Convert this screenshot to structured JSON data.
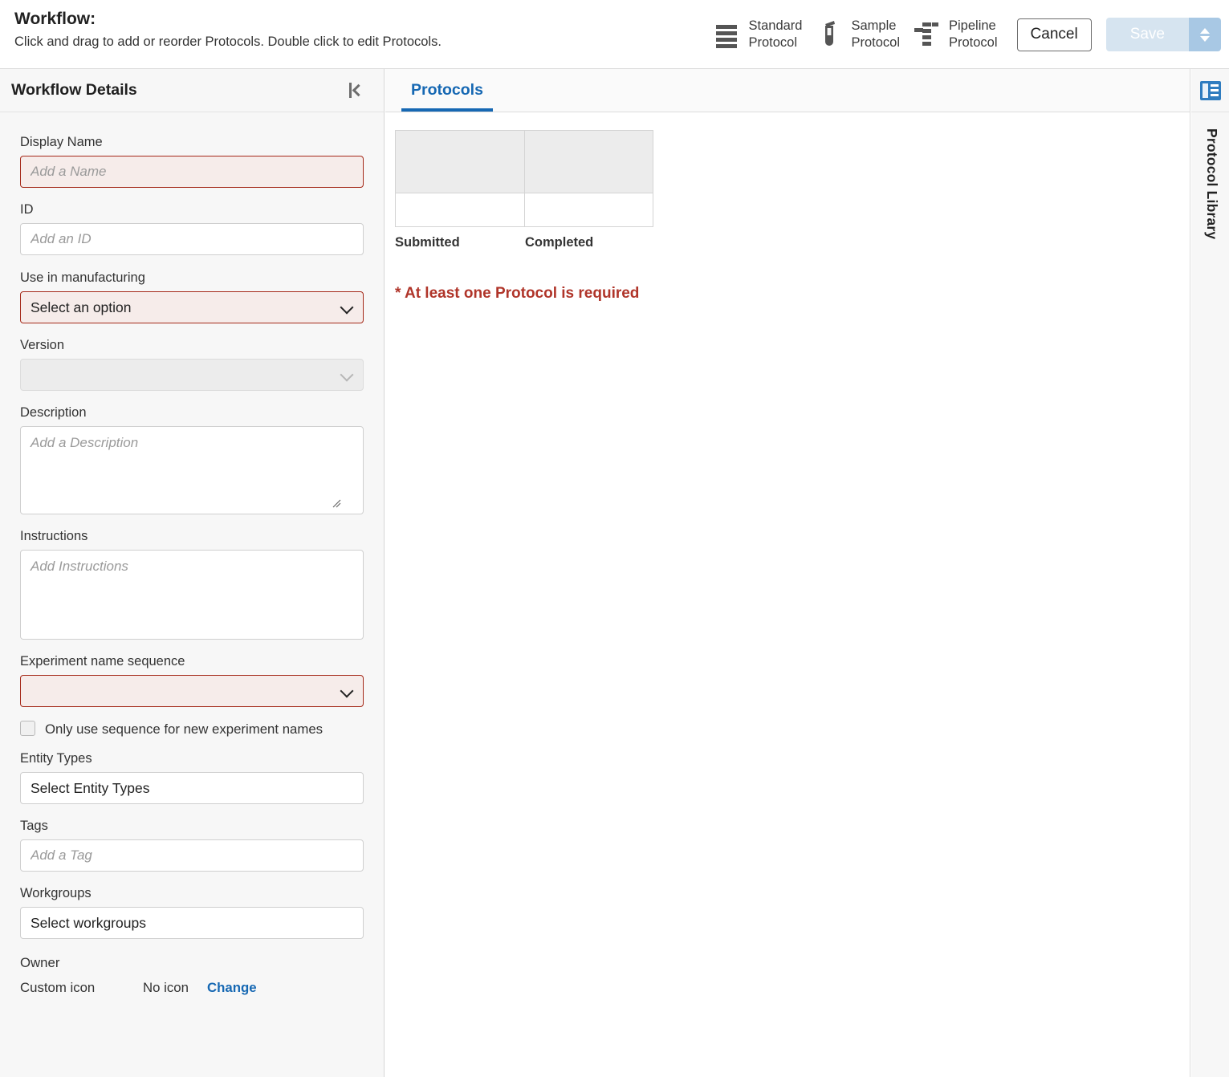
{
  "header": {
    "title": "Workflow:",
    "subtitle": "Click and drag to add or reorder Protocols. Double click to edit Protocols.",
    "protocol_buttons": [
      {
        "label": "Standard\nProtocol",
        "icon": "standard-protocol-icon"
      },
      {
        "label": "Sample\nProtocol",
        "icon": "sample-protocol-icon"
      },
      {
        "label": "Pipeline\nProtocol",
        "icon": "pipeline-protocol-icon"
      }
    ],
    "cancel_label": "Cancel",
    "save_label": "Save"
  },
  "sidebar": {
    "title": "Workflow Details",
    "collapse_icon": "collapse-panel-icon",
    "fields": {
      "display_name": {
        "label": "Display Name",
        "value": "",
        "placeholder": "Add a Name",
        "required": true
      },
      "id": {
        "label": "ID",
        "value": "",
        "placeholder": "Add an ID"
      },
      "use_in_manufacturing": {
        "label": "Use in manufacturing",
        "value": "Select an option",
        "required": true
      },
      "version": {
        "label": "Version",
        "value": "",
        "disabled": true
      },
      "description": {
        "label": "Description",
        "value": "",
        "placeholder": "Add a Description"
      },
      "instructions": {
        "label": "Instructions",
        "value": "",
        "placeholder": "Add Instructions"
      },
      "experiment_name_sequence": {
        "label": "Experiment name sequence",
        "value": "",
        "required": true
      },
      "only_use_sequence": {
        "label": "Only use sequence for new experiment names",
        "checked": false
      },
      "entity_types": {
        "label": "Entity Types",
        "value": "Select Entity Types"
      },
      "tags": {
        "label": "Tags",
        "value": "",
        "placeholder": "Add a Tag"
      },
      "workgroups": {
        "label": "Workgroups",
        "value": "Select workgroups"
      },
      "owner": {
        "label": "Owner",
        "value": ""
      },
      "custom_icon": {
        "label": "Custom icon",
        "value": "No icon",
        "action": "Change"
      }
    }
  },
  "main": {
    "tabs": [
      {
        "label": "Protocols",
        "active": true
      }
    ],
    "grid": {
      "column_labels": [
        "Submitted",
        "Completed"
      ],
      "header_cells": [
        "",
        ""
      ],
      "body_cells": [
        "",
        ""
      ]
    },
    "required_message": "* At least one Protocol is required"
  },
  "right_rail": {
    "icon": "protocol-library-icon",
    "label": "Protocol Library"
  },
  "colors": {
    "accent_blue": "#1668b3",
    "error_red": "#b0352a",
    "error_border": "#a52a1a",
    "error_bg": "#f6ecea",
    "panel_bg": "#f7f7f7",
    "save_disabled": "#d6e4f0",
    "save_caret": "#a8c8e4"
  }
}
